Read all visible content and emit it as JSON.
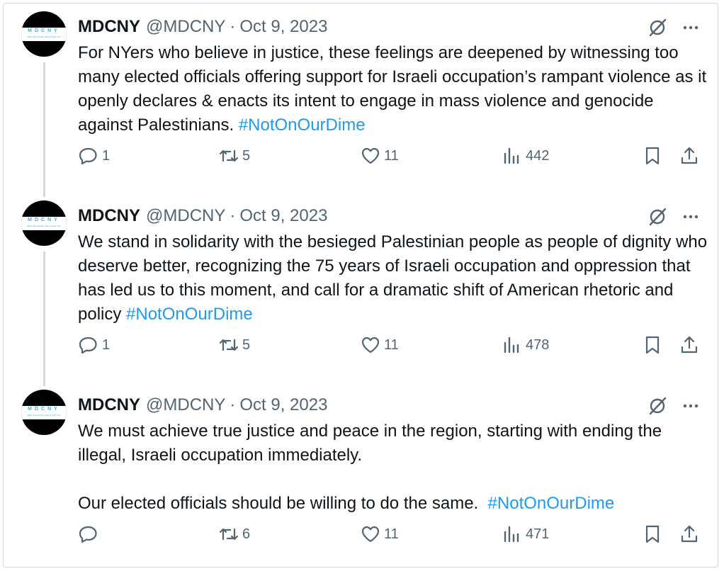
{
  "tweets": [
    {
      "name": "MDCNY",
      "handle": "@MDCNY",
      "separator": "·",
      "date": "Oct 9, 2023",
      "text": "For NYers who believe in justice, these feelings are deepened by witnessing too many elected officials offering support for Israeli occupation’s rampant violence as it openly declares & enacts its intent to engage in mass violence and genocide against Palestinians. ",
      "hashtag": "#NotOnOurDime",
      "replies": "1",
      "reposts": "5",
      "likes": "11",
      "views": "442"
    },
    {
      "name": "MDCNY",
      "handle": "@MDCNY",
      "separator": "·",
      "date": "Oct 9, 2023",
      "text": "We stand in solidarity with the besieged Palestinian people as people of dignity who deserve better, recognizing the 75 years of Israeli occupation and oppression that has led us to this moment, and call for a dramatic shift of American rhetoric and policy ",
      "hashtag": "#NotOnOurDime",
      "replies": "1",
      "reposts": "5",
      "likes": "11",
      "views": "478"
    },
    {
      "name": "MDCNY",
      "handle": "@MDCNY",
      "separator": "·",
      "date": "Oct 9, 2023",
      "text": "We must achieve true justice and peace in the region, starting with ending the illegal, Israeli occupation immediately.\n\nOur elected officials should be willing to do the same.  ",
      "hashtag": "#NotOnOurDime",
      "replies": "",
      "reposts": "6",
      "likes": "11",
      "views": "471"
    }
  ],
  "avatar": {
    "letters": "MDCNY",
    "subtitle": "Metro Democratic Club of New York"
  },
  "icons": {
    "grok": "grok-icon",
    "more": "more-icon",
    "reply": "reply-icon",
    "repost": "repost-icon",
    "like": "heart-icon",
    "views": "views-icon",
    "bookmark": "bookmark-icon",
    "share": "share-icon"
  },
  "colors": {
    "text": "#0f1419",
    "muted": "#536471",
    "link": "#1d9bf0",
    "border": "#cfd9de"
  }
}
